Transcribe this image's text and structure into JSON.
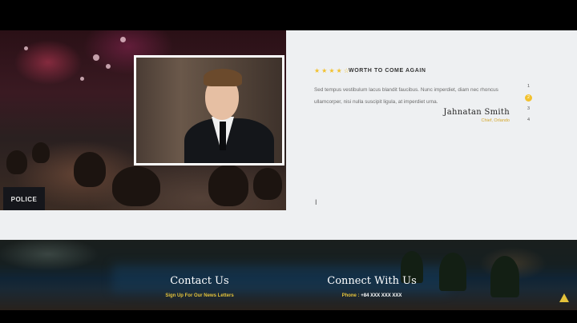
{
  "testimonial": {
    "rating_stars": "★★★★☆",
    "heading": "Worth to come again",
    "quote": "Sed tempus vestibulum lacus blandit faucibus. Nunc imperdiet, diam nec rhoncus ullamcorper, nisi nulla suscipit ligula, at imperdiet urna.",
    "author_name": "Jahnatan Smith",
    "author_role": "Chief, Orlando",
    "police_label": "POLICE",
    "pager": [
      "1",
      "2",
      "3",
      "4"
    ],
    "active_page": "2",
    "accent_color": "#f2c12e"
  },
  "footer": {
    "contact_title": "Contact Us",
    "contact_subtitle": "Sign Up For Our News Letters",
    "connect_title": "Connect With Us",
    "phone_label": "Phone :",
    "phone_value": "+84 XXX XXX XXX",
    "accent_color": "#e4c23a"
  }
}
